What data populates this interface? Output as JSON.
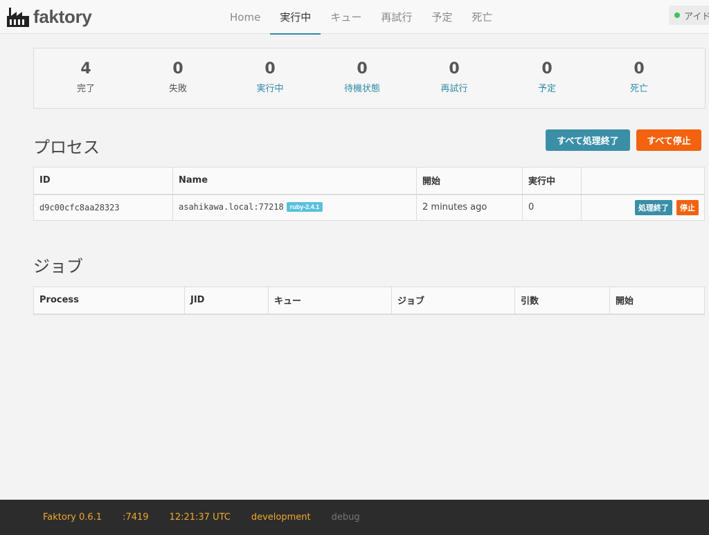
{
  "brand": {
    "name": "faktory",
    "logo_icon": "factory-icon"
  },
  "nav": {
    "items": [
      {
        "label": "Home",
        "active": false
      },
      {
        "label": "実行中",
        "active": true
      },
      {
        "label": "キュー",
        "active": false
      },
      {
        "label": "再試行",
        "active": false
      },
      {
        "label": "予定",
        "active": false
      },
      {
        "label": "死亡",
        "active": false
      }
    ],
    "status_label": "アイドル",
    "status_color": "#3cc35a"
  },
  "stats": [
    {
      "count": "4",
      "label": "完了"
    },
    {
      "count": "0",
      "label": "失敗"
    },
    {
      "count": "0",
      "label": "実行中"
    },
    {
      "count": "0",
      "label": "待機状態"
    },
    {
      "count": "0",
      "label": "再試行"
    },
    {
      "count": "0",
      "label": "予定"
    },
    {
      "count": "0",
      "label": "死亡"
    }
  ],
  "processes": {
    "title": "プロセス",
    "quiet_all_label": "すべて処理終了",
    "stop_all_label": "すべて停止",
    "columns": [
      "ID",
      "Name",
      "開始",
      "実行中",
      ""
    ],
    "rows": [
      {
        "id": "d9c00cfc8aa28323",
        "name": "asahikawa.local:77218",
        "tag": "ruby-2.4.1",
        "started": "2 minutes ago",
        "busy": "0",
        "quiet_label": "処理終了",
        "stop_label": "停止"
      }
    ]
  },
  "jobs": {
    "title": "ジョブ",
    "columns": [
      "Process",
      "JID",
      "キュー",
      "ジョブ",
      "引数",
      "開始"
    ]
  },
  "footer": {
    "version": "Faktory 0.6.1",
    "port": ":7419",
    "time": "12:21:37 UTC",
    "environment": "development",
    "debug": "debug"
  },
  "colors": {
    "accent": "#2e8aa8",
    "danger": "#f2620f",
    "footer_text": "#f0a830"
  }
}
